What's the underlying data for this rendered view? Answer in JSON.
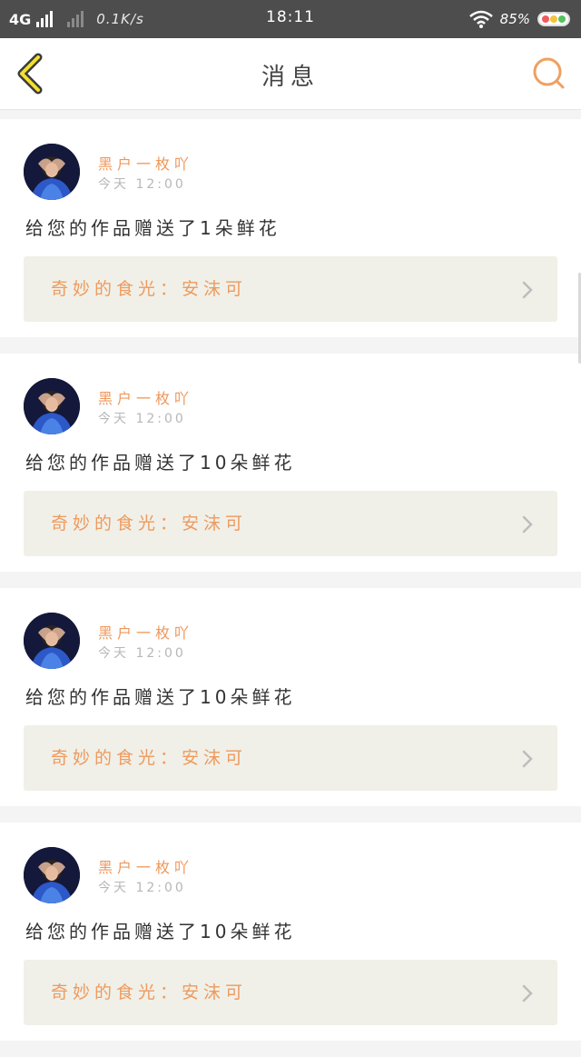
{
  "status_bar": {
    "network": "4G",
    "speed": "0.1K/s",
    "time": "18:11",
    "battery": "85%",
    "icons": [
      "signal-icon",
      "wifi-icon",
      "battery-icon"
    ]
  },
  "nav": {
    "title": "消息",
    "back_icon": "chevron-left-icon",
    "search_icon": "search-icon",
    "accent_color": "#f0a060"
  },
  "messages": [
    {
      "user": "黑户一枚吖",
      "time": "今天 12:00",
      "text": "给您的作品赠送了1朵鲜花",
      "work": "奇妙的食光：安沫可"
    },
    {
      "user": "黑户一枚吖",
      "time": "今天 12:00",
      "text": "给您的作品赠送了10朵鲜花",
      "work": "奇妙的食光：安沫可"
    },
    {
      "user": "黑户一枚吖",
      "time": "今天 12:00",
      "text": "给您的作品赠送了10朵鲜花",
      "work": "奇妙的食光：安沫可"
    },
    {
      "user": "黑户一枚吖",
      "time": "今天 12:00",
      "text": "给您的作品赠送了10朵鲜花",
      "work": "奇妙的食光：安沫可"
    }
  ],
  "colors": {
    "name": "#f0975a",
    "work_title": "#ee9a5e",
    "work_bg": "#f0f0e8"
  }
}
